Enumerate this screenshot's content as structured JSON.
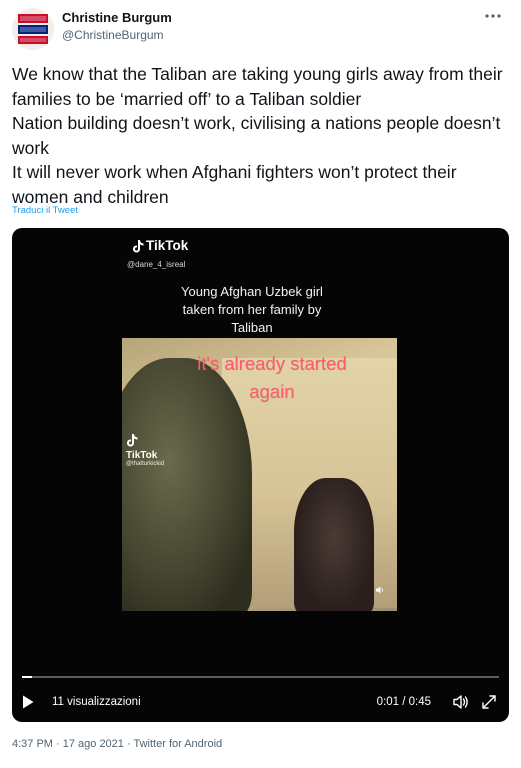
{
  "author": {
    "name": "Christine Burgum",
    "handle": "@ChristineBurgum"
  },
  "tweet": {
    "lines": [
      "We know that the Taliban are taking young girls away from their families to be ‘married off’ to a Taliban soldier",
      "Nation building doesn’t work, civilising a nations people doesn’t work",
      "It will never work when Afghani fighters won’t protect their women and children"
    ],
    "translate_label": "Traduci il Tweet"
  },
  "video": {
    "tiktok_label": "TikTok",
    "tiktok_user_top": "@dane_4_isreal",
    "caption": "Young Afghan Uzbek girl\ntaken from her family by\nTaliban",
    "overlay_text": "it's already started\nagain",
    "tiktok_user_mid": "@thatturkickid",
    "views": "11 visualizzazioni",
    "time": "0:01 / 0:45",
    "progress_fraction": 0.02
  },
  "footer": {
    "meta": "4:37 PM · 17 ago 2021 · Twitter for Android"
  },
  "icons": {
    "more": "more-icon",
    "play": "play-icon",
    "volume": "volume-icon",
    "fullscreen": "fullscreen-icon"
  },
  "colors": {
    "link": "#1d9bf0",
    "text": "#0f1419",
    "secondary": "#536471"
  }
}
